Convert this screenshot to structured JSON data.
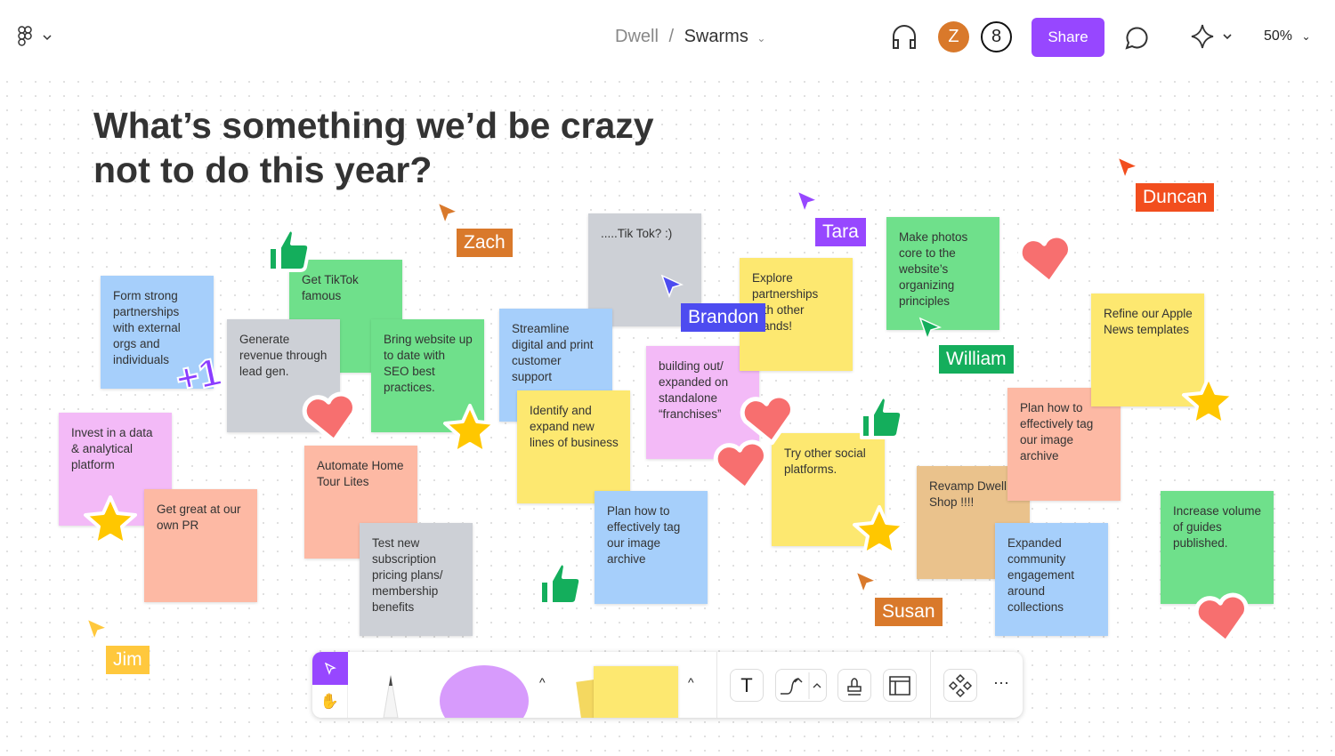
{
  "header": {
    "breadcrumb_team": "Dwell",
    "breadcrumb_sep": "/",
    "breadcrumb_file": "Swarms",
    "avatar_initial": "Z",
    "user_count": "8",
    "share_label": "Share",
    "zoom": "50%",
    "accent": "#9747ff"
  },
  "board": {
    "title": "What’s something we’d be crazy not to do this year?"
  },
  "stickies": [
    {
      "text": "Form strong partnerships with external orgs and individuals",
      "color": "#a6cffb"
    },
    {
      "text": "Get TikTok famous",
      "color": "#6fe08b"
    },
    {
      "text": "Generate revenue through lead gen.",
      "color": "#cdd0d6"
    },
    {
      "text": "Bring website up to date with SEO best practices.",
      "color": "#6fe08b"
    },
    {
      "text": "Invest in a data & analytical platform",
      "color": "#f3baf7"
    },
    {
      "text": "Get great at our own PR",
      "color": "#fdb9a4"
    },
    {
      "text": "Automate Home Tour Lites",
      "color": "#fdb9a4"
    },
    {
      "text": "Test new subscription pricing plans/ membership benefits",
      "color": "#cdd0d6"
    },
    {
      "text": ".....Tik Tok? :)",
      "color": "#cdd0d6"
    },
    {
      "text": "Streamline digital and print customer support",
      "color": "#a6cffb"
    },
    {
      "text": "Identify and expand new lines of business",
      "color": "#fde870"
    },
    {
      "text": "Plan how to effectively tag our image archive",
      "color": "#a6cffb"
    },
    {
      "text": "building out/ expanded on standalone “franchises”",
      "color": "#f3baf7"
    },
    {
      "text": "Explore partnerships with other brands!",
      "color": "#fde870"
    },
    {
      "text": "Try other social platforms.",
      "color": "#fde870"
    },
    {
      "text": "Make photos core to the website’s organizing principles",
      "color": "#6fe08b"
    },
    {
      "text": "Revamp Dwell Shop !!!!",
      "color": "#eac28c"
    },
    {
      "text": "Plan how to effectively tag our image archive",
      "color": "#fdb9a4"
    },
    {
      "text": "Expanded community engagement around collections",
      "color": "#a6cffb"
    },
    {
      "text": "Refine our Apple News templates",
      "color": "#fde870"
    },
    {
      "text": "Increase volume of guides published.",
      "color": "#6fe08b"
    }
  ],
  "cursors": [
    {
      "name": "Zach",
      "color": "#d9792b"
    },
    {
      "name": "Tara",
      "color": "#9747ff"
    },
    {
      "name": "Brandon",
      "color": "#4d4cf0"
    },
    {
      "name": "Duncan",
      "color": "#f24e1e"
    },
    {
      "name": "William",
      "color": "#14ae5c"
    },
    {
      "name": "Susan",
      "color": "#d9792b"
    },
    {
      "name": "Jim",
      "color": "#ffc83d"
    }
  ],
  "stickers": [
    {
      "type": "thumbs-up"
    },
    {
      "type": "plus-one",
      "text": "+1"
    },
    {
      "type": "heart"
    },
    {
      "type": "star"
    },
    {
      "type": "star"
    },
    {
      "type": "heart"
    },
    {
      "type": "heart"
    },
    {
      "type": "thumbs-up"
    },
    {
      "type": "star"
    },
    {
      "type": "thumbs-up"
    },
    {
      "type": "heart"
    },
    {
      "type": "star"
    },
    {
      "type": "heart"
    },
    {
      "type": "star"
    }
  ],
  "toolbar": {
    "tools": [
      "select",
      "hand",
      "marker",
      "shape",
      "sticky-note",
      "text",
      "connector",
      "stamp",
      "section",
      "more-components"
    ],
    "more": "···",
    "text_tool": "T"
  }
}
